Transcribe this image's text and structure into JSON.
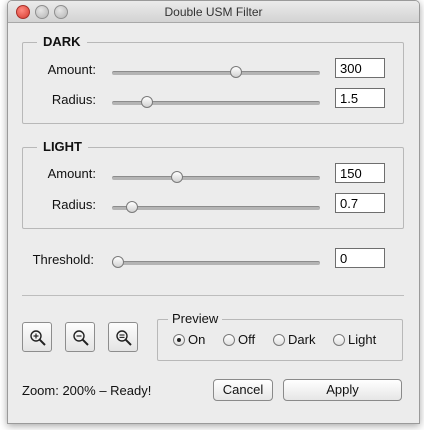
{
  "window": {
    "title": "Double USM Filter"
  },
  "dark": {
    "label": "DARK",
    "amount_label": "Amount:",
    "amount_value": "300",
    "amount_level": 0.6,
    "radius_label": "Radius:",
    "radius_value": "1.5",
    "radius_level": 0.15
  },
  "light": {
    "label": "LIGHT",
    "amount_label": "Amount:",
    "amount_value": "150",
    "amount_level": 0.3,
    "radius_label": "Radius:",
    "radius_value": "0.7",
    "radius_level": 0.07
  },
  "threshold": {
    "label": "Threshold:",
    "value": "0",
    "level": 0.0
  },
  "zoom_buttons": [
    "zoom-in-icon",
    "zoom-out-icon",
    "zoom-fit-icon"
  ],
  "preview": {
    "label": "Preview",
    "options": [
      "On",
      "Off",
      "Dark",
      "Light"
    ],
    "selected": "On"
  },
  "status": "Zoom: 200% – Ready!",
  "actions": {
    "cancel": "Cancel",
    "apply": "Apply"
  }
}
